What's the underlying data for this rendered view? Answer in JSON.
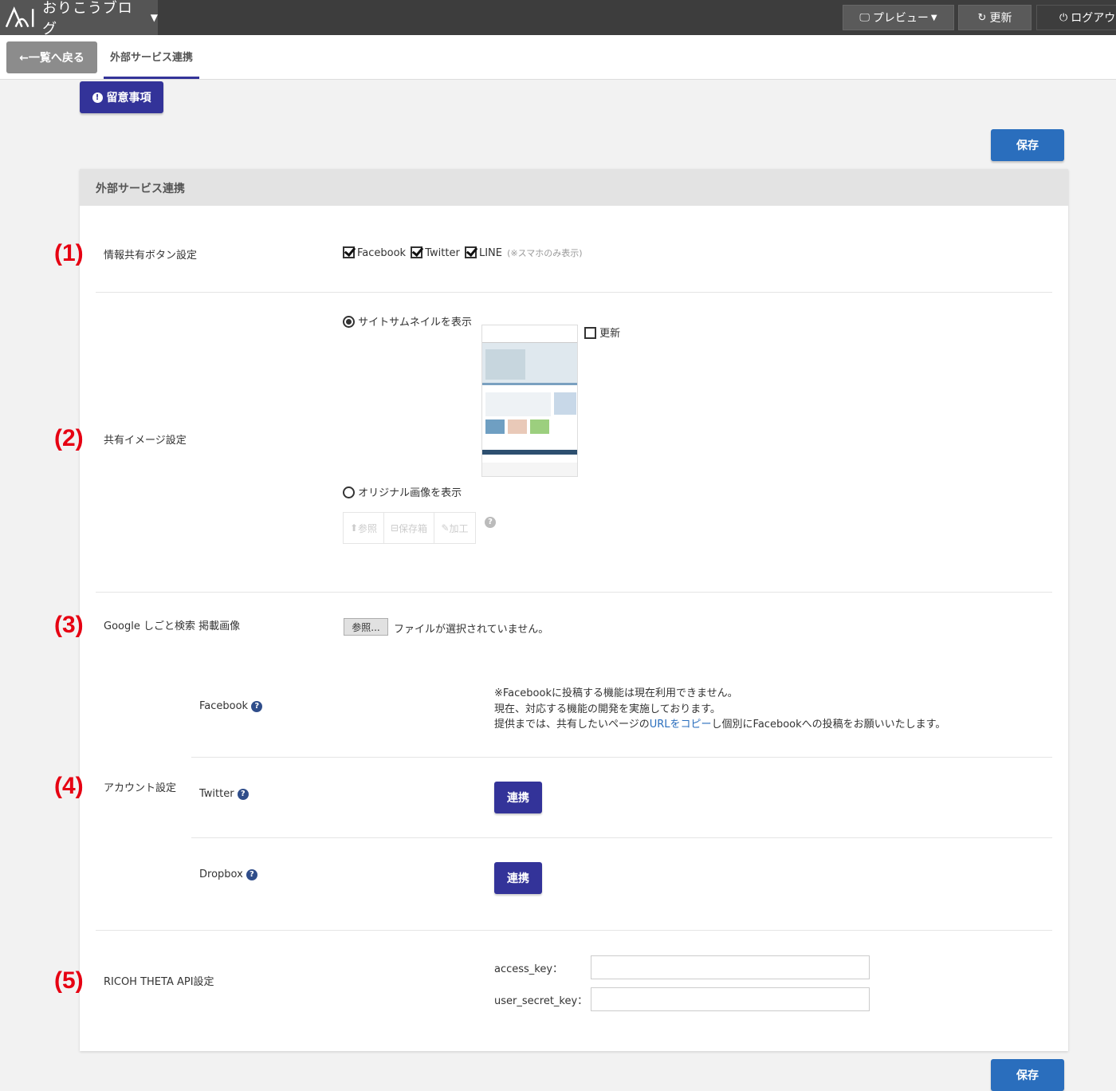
{
  "topbar": {
    "brand_name": "おりこうブログ",
    "preview_label": "プレビュー",
    "refresh_label": "更新",
    "logout_label": "ログアウ"
  },
  "subnav": {
    "back_label": "←一覧へ戻る",
    "tab_label": "外部サービス連携"
  },
  "notice_label": "留意事項",
  "save_label": "保存",
  "panel": {
    "title": "外部サービス連携"
  },
  "sections": {
    "s1": {
      "number": "(1)",
      "label": "情報共有ボタン設定",
      "options": [
        "Facebook",
        "Twitter",
        "LINE"
      ],
      "line_note": "(※スマホのみ表示)"
    },
    "s2": {
      "number": "(2)",
      "label": "共有イメージ設定",
      "thumbnail_option": "サイトサムネイルを表示",
      "refresh_check": "更新",
      "original_option": "オリジナル画像を表示",
      "tool_buttons": [
        "参照",
        "保存箱",
        "加工"
      ]
    },
    "s3": {
      "number": "(3)",
      "label": "Google しごと検索 掲載画像",
      "file_button": "参照...",
      "file_status": "ファイルが選択されていません。"
    },
    "s4": {
      "number": "(4)",
      "label": "アカウント設定",
      "facebook_label": "Facebook",
      "facebook_msg_line1": "※Facebookに投稿する機能は現在利用できません。",
      "facebook_msg_line2": "現在、対応する機能の開発を実施しております。",
      "facebook_msg_line3_pre": "提供までは、共有したいページの",
      "facebook_msg_link": "URLをコピー",
      "facebook_msg_line3_post": "し個別にFacebookへの投稿をお願いいたします。",
      "twitter_label": "Twitter",
      "dropbox_label": "Dropbox",
      "link_button": "連携"
    },
    "s5": {
      "number": "(5)",
      "label": "RICOH THETA API設定",
      "access_key_label": "access_key：",
      "access_key_value": "",
      "user_secret_key_label": "user_secret_key：",
      "user_secret_key_value": ""
    }
  },
  "colors": {
    "accent": "#333399",
    "save": "#2a6ebd",
    "number_red": "#e60012"
  }
}
